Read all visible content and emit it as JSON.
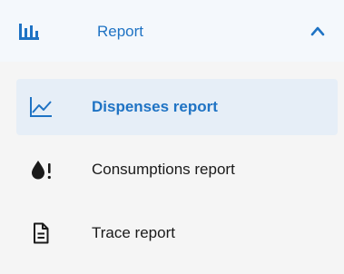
{
  "menu": {
    "section": {
      "label": "Report",
      "icon": "bar-chart-icon",
      "expanded": true,
      "accent_color": "#1f73c4"
    },
    "items": [
      {
        "label": "Dispenses report",
        "icon": "line-chart-icon",
        "active": true
      },
      {
        "label": "Consumptions report",
        "icon": "drop-alert-icon",
        "active": false
      },
      {
        "label": "Trace report",
        "icon": "document-icon",
        "active": false
      }
    ]
  }
}
